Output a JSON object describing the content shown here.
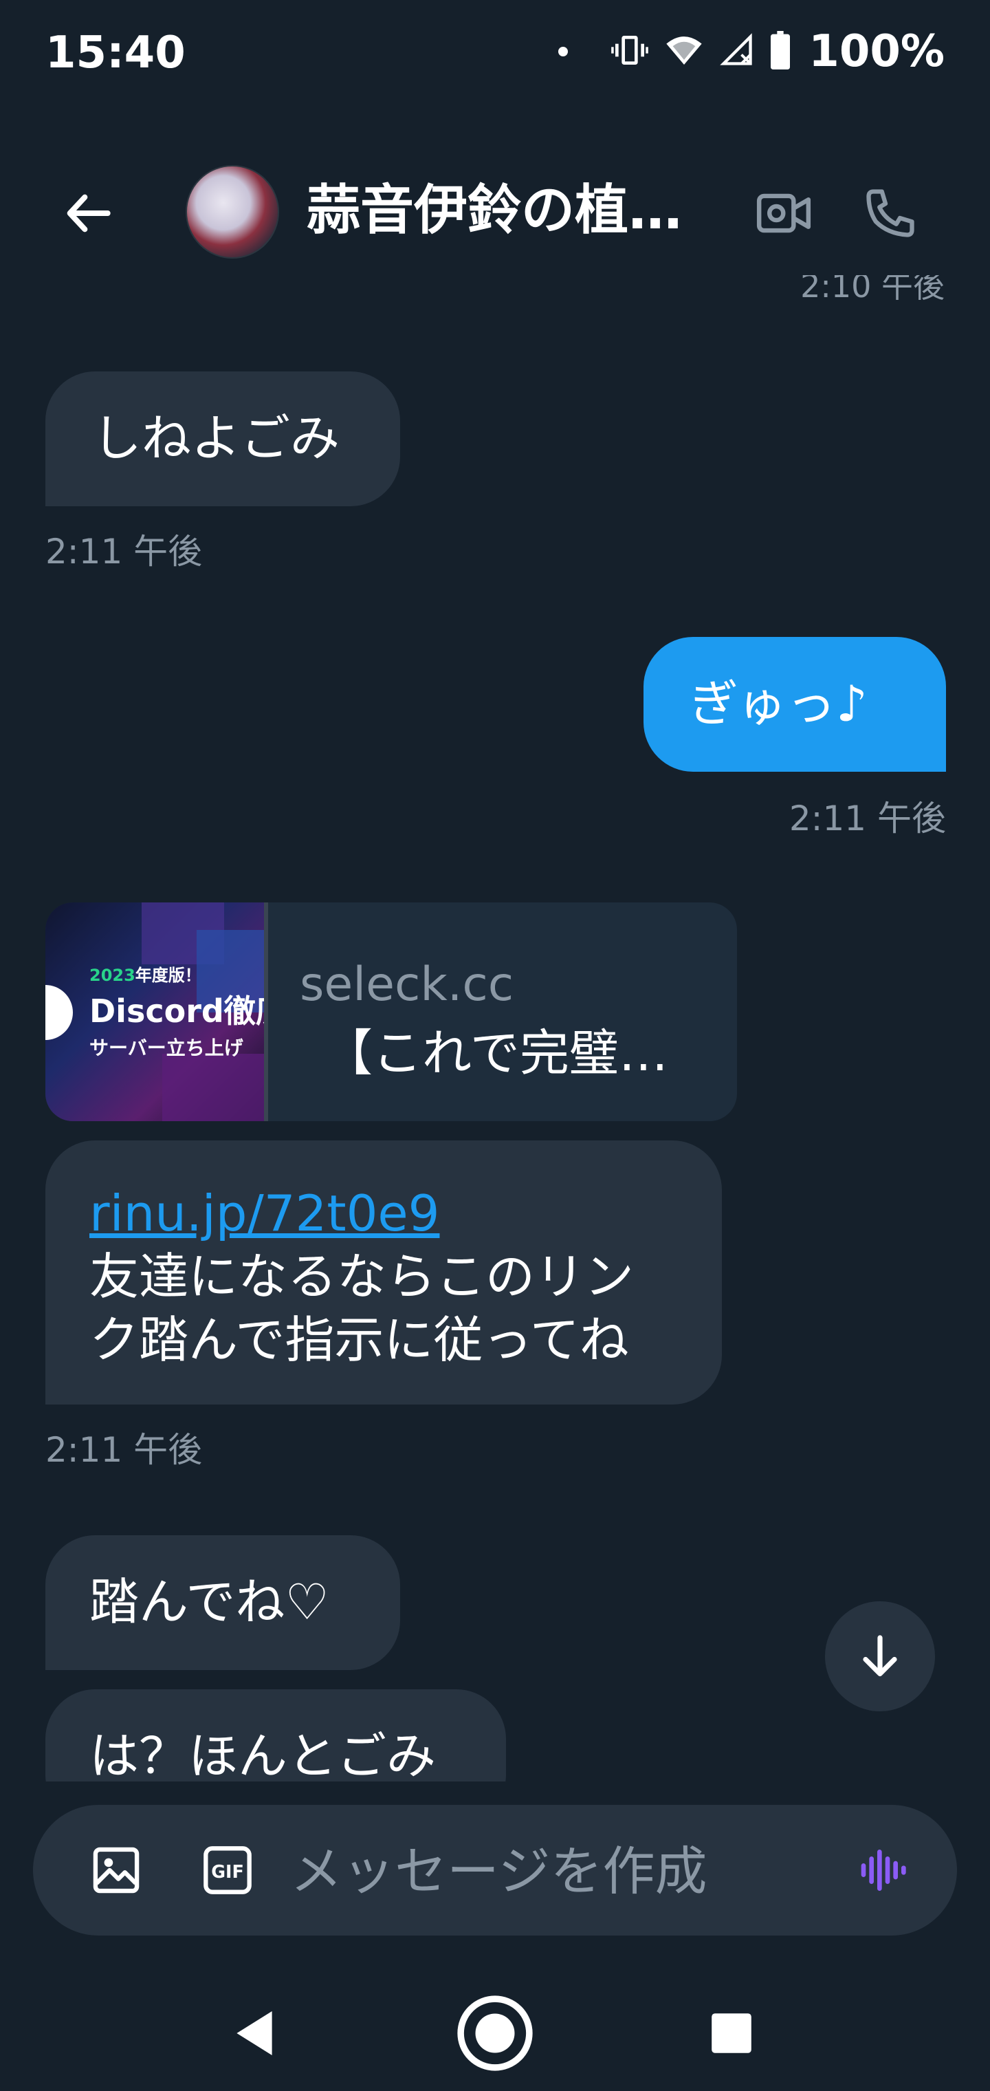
{
  "status_bar": {
    "time": "15:40",
    "battery": "100%"
  },
  "header": {
    "title": "蒜音伊鈴の植…"
  },
  "messages": {
    "partial_timestamp": "2:10 午後",
    "m1": {
      "text": "しねよごみ",
      "time": "2:11 午後"
    },
    "m2": {
      "text": "ぎゅっ♪",
      "time": "2:11 午後"
    },
    "card": {
      "thumb_year": "2023",
      "thumb_year_suffix": "年度版！",
      "thumb_title": "Discord徹底",
      "thumb_sub": "サーバー立ち上げ",
      "domain": "seleck.cc",
      "title": "【これで完璧…"
    },
    "m3": {
      "link": "rinu.jp/72t0e9",
      "line1": "友達になるならこのリン",
      "line2": "ク踏んで指示に従ってね",
      "time": "2:11 午後"
    },
    "m4": {
      "text": "踏んでね♡"
    },
    "m5": {
      "text": "は？ほんとごみ"
    }
  },
  "composer": {
    "placeholder": "メッセージを作成"
  },
  "colors": {
    "background": "#15202b",
    "incoming_bubble": "#273340",
    "outgoing_bubble": "#1d9bf0",
    "muted_text": "#8b98a5",
    "voice_accent": "#8b5cf6"
  }
}
